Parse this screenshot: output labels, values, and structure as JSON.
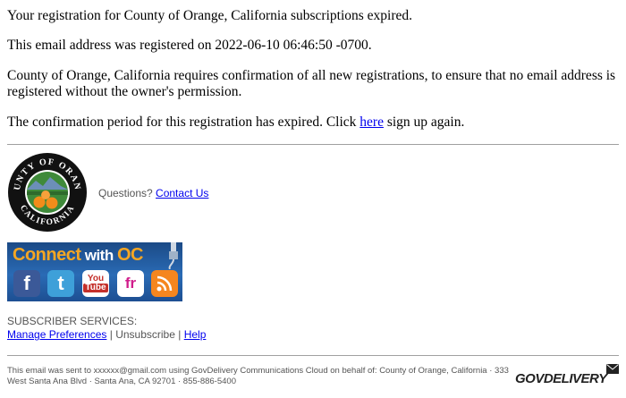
{
  "message": {
    "line1": "Your registration for County of Orange, California subscriptions expired.",
    "line2": "This email address was registered on 2022-06-10 06:46:50 -0700.",
    "line3": "County of Orange, California requires confirmation of all new registrations, to ensure that no email address is registered without the owner's permission.",
    "line4_before": "The confirmation period for this registration has expired. Click ",
    "line4_link": "here",
    "line4_after": " sign up again."
  },
  "seal": {
    "top_text": "COUNTY OF ORANGE",
    "of_text": "OF",
    "bottom_text": "CALIFORNIA"
  },
  "questions": {
    "label": "Questions? ",
    "link": "Contact Us"
  },
  "connect": {
    "connect_word": "Connect",
    "with_word": " with ",
    "oc_word": "OC",
    "icons": {
      "facebook": "f",
      "twitter": "t",
      "youtube_top": "You",
      "youtube_bottom": "Tube",
      "friendfeed": "fr",
      "rss": "rss-icon"
    }
  },
  "subscriber": {
    "heading": "SUBSCRIBER SERVICES:",
    "manage": "Manage Preferences",
    "sep1": " | ",
    "unsubscribe": "Unsubscribe",
    "sep2": " | ",
    "help": "Help"
  },
  "footer": {
    "text": "This email was sent to xxxxxx@gmail.com using GovDelivery Communications Cloud on behalf of: County of Orange, California · 333 West Santa Ana Blvd · Santa Ana, CA 92701 · 855-886-5400",
    "brand": "GOVDELIVERY"
  },
  "colors": {
    "link": "#0000ee",
    "connect_bg": "#2a6bb5",
    "connect_accent": "#f5a623",
    "rss": "#f5861f",
    "facebook": "#3b5998",
    "twitter": "#3ea0d9"
  }
}
